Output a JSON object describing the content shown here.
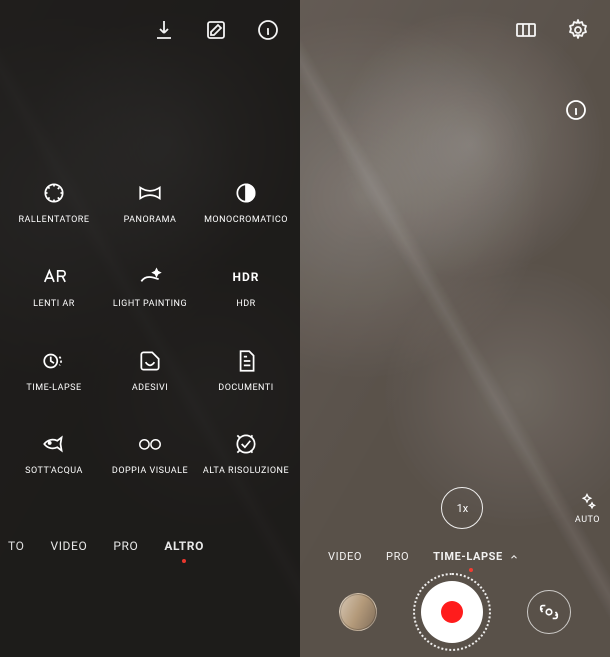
{
  "left": {
    "modes": [
      {
        "id": "rallentatore",
        "label": "RALLENTATORE",
        "icon": "dial"
      },
      {
        "id": "panorama",
        "label": "PANORAMA",
        "icon": "panorama"
      },
      {
        "id": "monocromatico",
        "label": "MONOCROMATICO",
        "icon": "contrast"
      },
      {
        "id": "lenti-ar",
        "label": "LENTI AR",
        "icon": "ar"
      },
      {
        "id": "light-painting",
        "label": "LIGHT PAINTING",
        "icon": "sparkle"
      },
      {
        "id": "hdr",
        "label": "HDR",
        "icon": "hdr"
      },
      {
        "id": "time-lapse",
        "label": "TIME-LAPSE",
        "icon": "timelapse"
      },
      {
        "id": "adesivi",
        "label": "ADESIVI",
        "icon": "sticker"
      },
      {
        "id": "documenti",
        "label": "DOCUMENTI",
        "icon": "document"
      },
      {
        "id": "sottacqua",
        "label": "SOTT'ACQUA",
        "icon": "fish"
      },
      {
        "id": "doppia-visuale",
        "label": "DOPPIA VISUALE",
        "icon": "dual"
      },
      {
        "id": "alta-risoluzione",
        "label": "ALTA RISOLUZIONE",
        "icon": "hires"
      }
    ],
    "tabs": {
      "items": [
        "TO",
        "VIDEO",
        "PRO",
        "ALTRO"
      ],
      "hdr_glyph": "HDR",
      "active_index": 3
    }
  },
  "right": {
    "speed": "1x",
    "auto_label": "AUTO",
    "tabs": {
      "items": [
        "VIDEO",
        "PRO",
        "TIME-LAPSE"
      ],
      "active_index": 2
    }
  }
}
